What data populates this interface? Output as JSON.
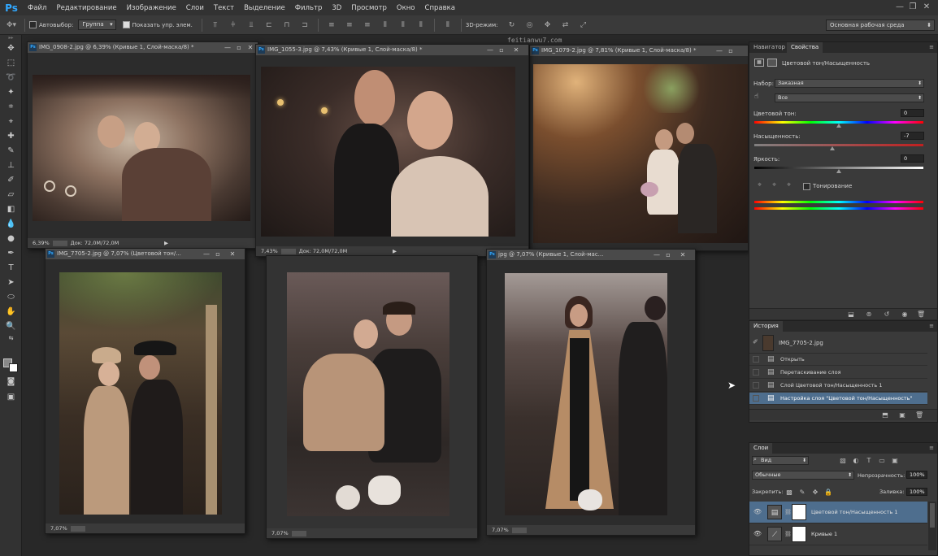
{
  "app": {
    "logo": "Ps"
  },
  "menu": [
    "Файл",
    "Редактирование",
    "Изображение",
    "Слои",
    "Текст",
    "Выделение",
    "Фильтр",
    "3D",
    "Просмотр",
    "Окно",
    "Справка"
  ],
  "options": {
    "autoselect_label": "Автовыбор:",
    "autoselect_value": "Группа",
    "show_controls_label": "Показать упр. элем.",
    "mode3d_label": "3D-режим:",
    "watermark": "feitianwu7.com",
    "workspace": "Основная рабочая среда"
  },
  "documents": [
    {
      "title": "IMG_0908-2.jpg @ 6,39% (Кривые 1, Слой-маска/8) *",
      "zoom": "6,39%",
      "doc": "Док: 72,0M/72,0M"
    },
    {
      "title": "IMG_1055-3.jpg @ 7,43% (Кривые 1, Слой-маска/8) *",
      "zoom": "7,43%",
      "doc": "Док: 72,0M/72,0M"
    },
    {
      "title": "IMG_1079-2.jpg @ 7,81% (Кривые 1, Слой-маска/8) *",
      "zoom": "",
      "doc": ""
    },
    {
      "title": "IMG_7705-2.jpg @ 7,07% (Цветовой тон/...",
      "zoom": "7,07%",
      "doc": ""
    },
    {
      "title": "",
      "zoom": "7,07%",
      "doc": ""
    },
    {
      "title": "jpg @ 7,07% (Кривые 1, Слой-мас...",
      "zoom": "7,07%",
      "doc": ""
    }
  ],
  "properties": {
    "tabs": [
      "Навигатор",
      "Свойства"
    ],
    "heading": "Цветовой тон/Насыщенность",
    "preset_label": "Набор:",
    "preset_value": "Заказная",
    "channel_value": "Все",
    "hue_label": "Цветовой тон:",
    "hue_value": "0",
    "sat_label": "Насыщенность:",
    "sat_value": "-7",
    "light_label": "Яркость:",
    "light_value": "0",
    "colorize_label": "Тонирование"
  },
  "history": {
    "tab": "История",
    "snapshot": "IMG_7705-2.jpg",
    "items": [
      "Открыть",
      "Перетаскивание слоя",
      "Слой Цветовой тон/Насыщенность 1",
      "Настройка слоя \"Цветовой тон/Насыщенность\""
    ]
  },
  "layers": {
    "tab": "Слои",
    "filter": "Вид",
    "blend": "Обычные",
    "opacity_label": "Непрозрачность:",
    "opacity_value": "100%",
    "lock_label": "Закрепить:",
    "fill_label": "Заливка:",
    "fill_value": "100%",
    "items": [
      "Цветовой тон/Насыщенность 1",
      "Кривые 1"
    ]
  },
  "colors": {
    "accent": "#31a8ff",
    "selection": "#4e6e8e",
    "panel": "#3a3a3a",
    "bg": "#282828"
  }
}
